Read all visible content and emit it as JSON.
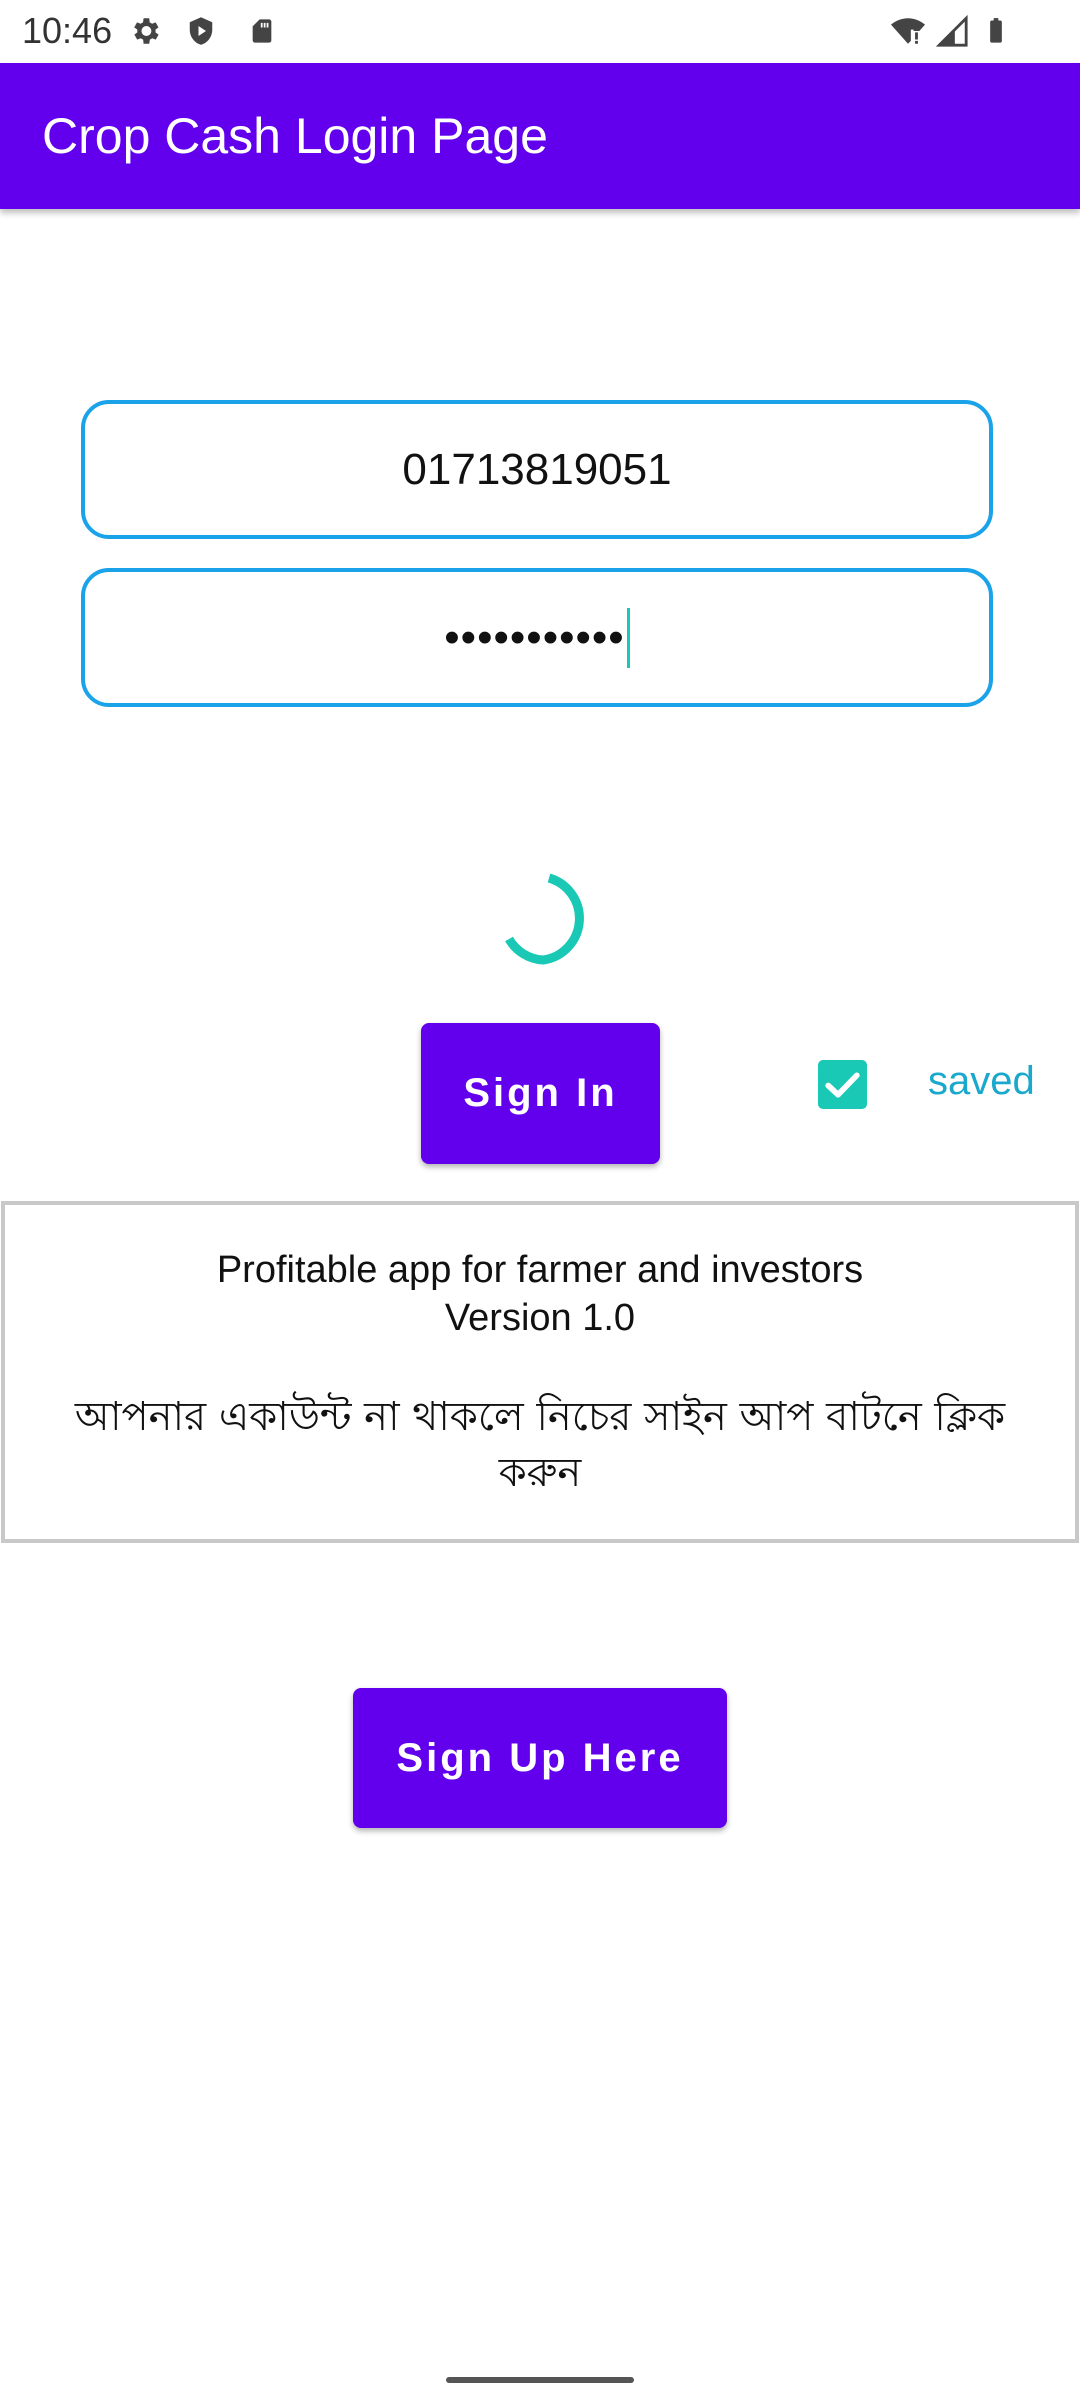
{
  "status_bar": {
    "time": "10:46",
    "left_icons": [
      "gear-icon",
      "shield-play-icon",
      "sd-card-icon"
    ],
    "right_icons": [
      "wifi-alert-icon",
      "cell-signal-icon",
      "battery-icon"
    ]
  },
  "app_bar": {
    "title": "Crop Cash Login Page",
    "color": "#6200EE"
  },
  "login_form": {
    "phone_value": "01713819051",
    "password_mask": "•••••••••••",
    "input_border_color": "#1AA3E8"
  },
  "progress": {
    "icon": "loading-spinner-icon",
    "color": "#1AC8B6"
  },
  "actions": {
    "sign_in_label": "Sign In",
    "saved_checked": true,
    "saved_label": "saved",
    "sign_up_label": "Sign Up Here"
  },
  "info": {
    "line1": "Profitable app for farmer and investors",
    "line2": "Version 1.0",
    "bengali_note": "আপনার একাউন্ট না থাকলে নিচের সাইন আপ বাটনে ক্লিক করুন"
  }
}
